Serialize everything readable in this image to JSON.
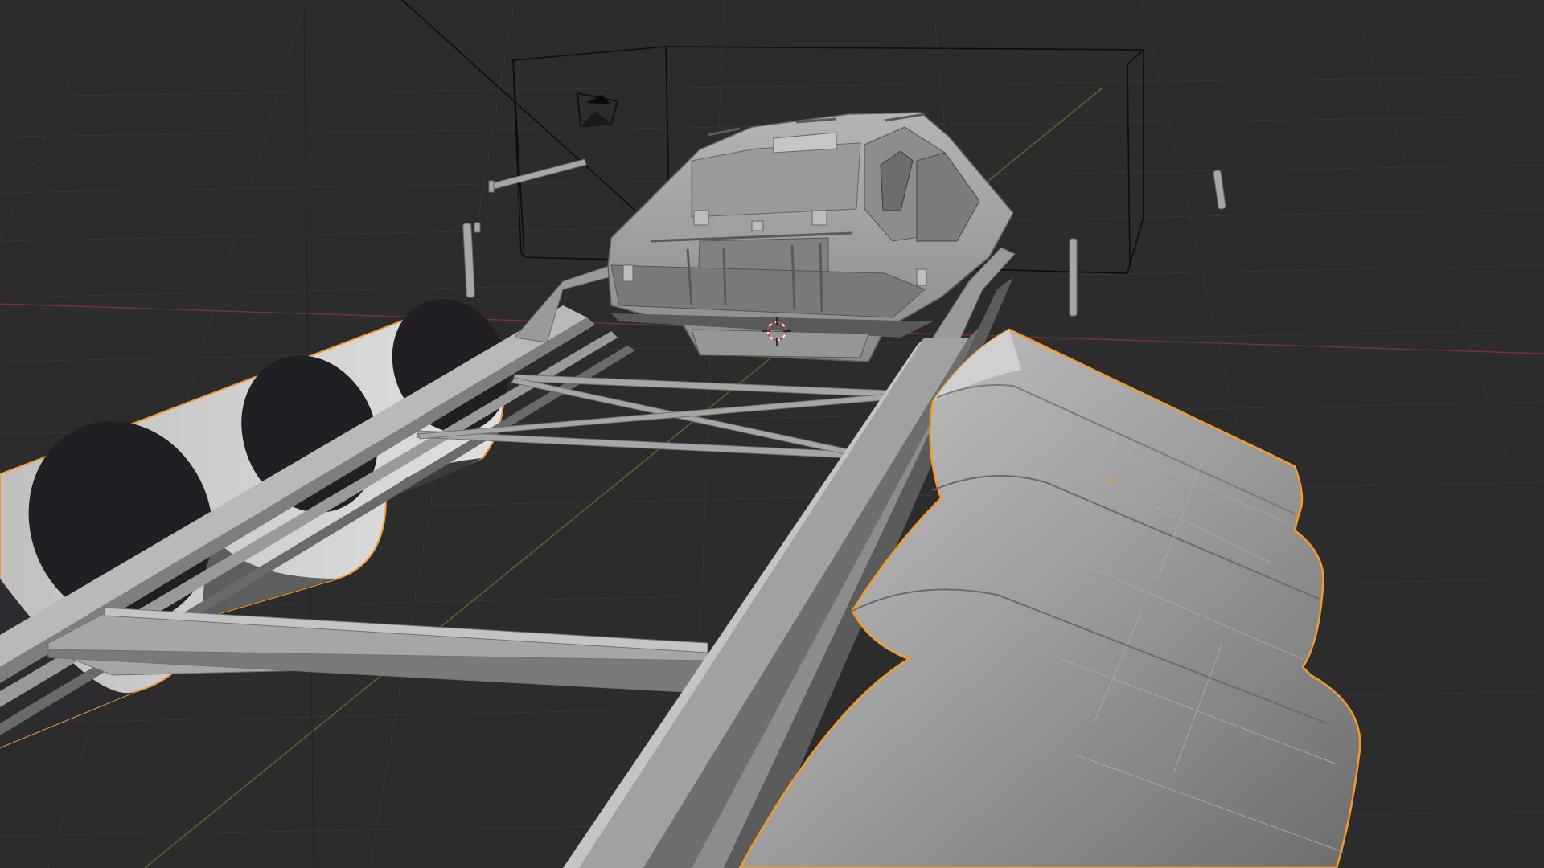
{
  "viewport": {
    "background": "#2c2c2c",
    "grid_color": "#353535",
    "axis_x_color": "#8a3434",
    "axis_y_color": "#5c7f2a",
    "mesh_color": "#8e8e8e",
    "mesh_shadow_color": "#1f1f23",
    "selection_outline_color": "#f29a2e",
    "wire_color": "#0c0c0c",
    "cursor_color": "#d43a3a"
  },
  "objects": {
    "vehicle_cab": "vehicle-cab-mesh",
    "chassis_frame": "chassis-frame-mesh",
    "left_tread": "left-tread-selected",
    "right_tread": "right-tread-selected",
    "camera": "camera-icon",
    "bounding_box": "bounding-box-wire",
    "cursor": "3d-cursor-icon"
  }
}
